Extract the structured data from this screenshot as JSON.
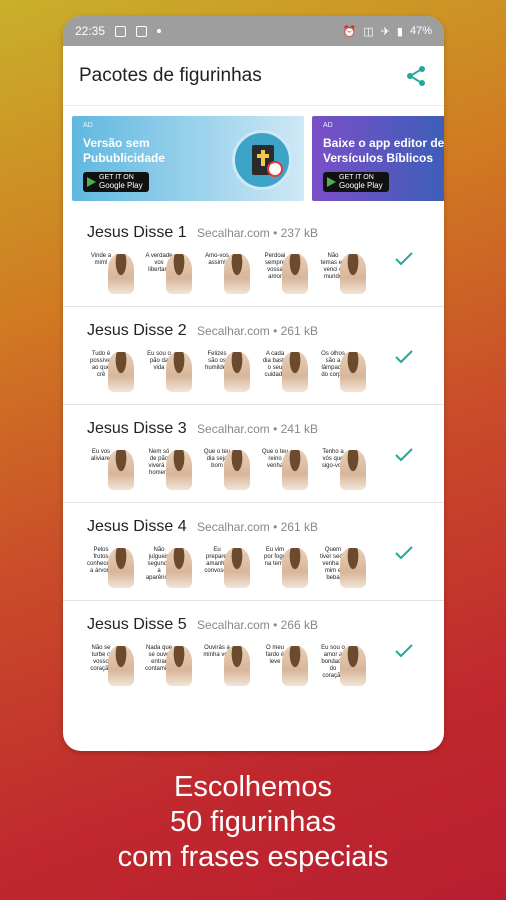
{
  "status": {
    "time": "22:35",
    "battery": "47%"
  },
  "appbar": {
    "title": "Pacotes de figurinhas",
    "share_icon": "share-icon"
  },
  "banners": [
    {
      "ad": "AD",
      "text": "Versão sem Pubublicidade",
      "store": "Google Play",
      "store_top": "GET IT ON"
    },
    {
      "ad": "AD",
      "text": "Baixe o app editor de Versículos Bíblicos",
      "store": "Google Play",
      "store_top": "GET IT ON"
    }
  ],
  "packs": [
    {
      "name": "Jesus Disse 1",
      "meta": "Secalhar.com • 237 kB",
      "stickers": [
        "Vinde a mim!",
        "A verdade vos libertará",
        "Amo-vos assim!",
        "Perdoai sempre vossa amor",
        "Não temas eu venci o mundo"
      ]
    },
    {
      "name": "Jesus Disse 2",
      "meta": "Secalhar.com • 261 kB",
      "stickers": [
        "Tudo é possível ao que crê",
        "Eu sou o pão da vida",
        "Felizes são os humildes",
        "A cada dia basta o seu cuidado",
        "Os olhos são a lâmpada do corpo"
      ]
    },
    {
      "name": "Jesus Disse 3",
      "meta": "Secalhar.com • 241 kB",
      "stickers": [
        "Eu vos aliviarei",
        "Nem só de pão viverá o homem",
        "Que o teu dia seja bom",
        "Que o teu reino venha",
        "Tenho a vós que sigo-vos"
      ]
    },
    {
      "name": "Jesus Disse 4",
      "meta": "Secalhar.com • 261 kB",
      "stickers": [
        "Pelos frutos conhecereis a árvore",
        "Não julgueis segundo a aparência",
        "Eu preparei amanhã convosco",
        "Eu vim por fogo na terra",
        "Quem tiver sede venha a mim e beba"
      ]
    },
    {
      "name": "Jesus Disse 5",
      "meta": "Secalhar.com • 266 kB",
      "stickers": [
        "Não se turbe o vosso coração",
        "Nada que se ouve entrar contamina",
        "Ouvirás a minha voz",
        "O meu fardo é leve",
        "Eu sou o amor a bondade do coração"
      ]
    }
  ],
  "caption": [
    "Escolhemos",
    "50 figurinhas",
    "com frases especiais"
  ],
  "colors": {
    "accent": "#26a69a",
    "statusbar": "#9e9e9e"
  }
}
